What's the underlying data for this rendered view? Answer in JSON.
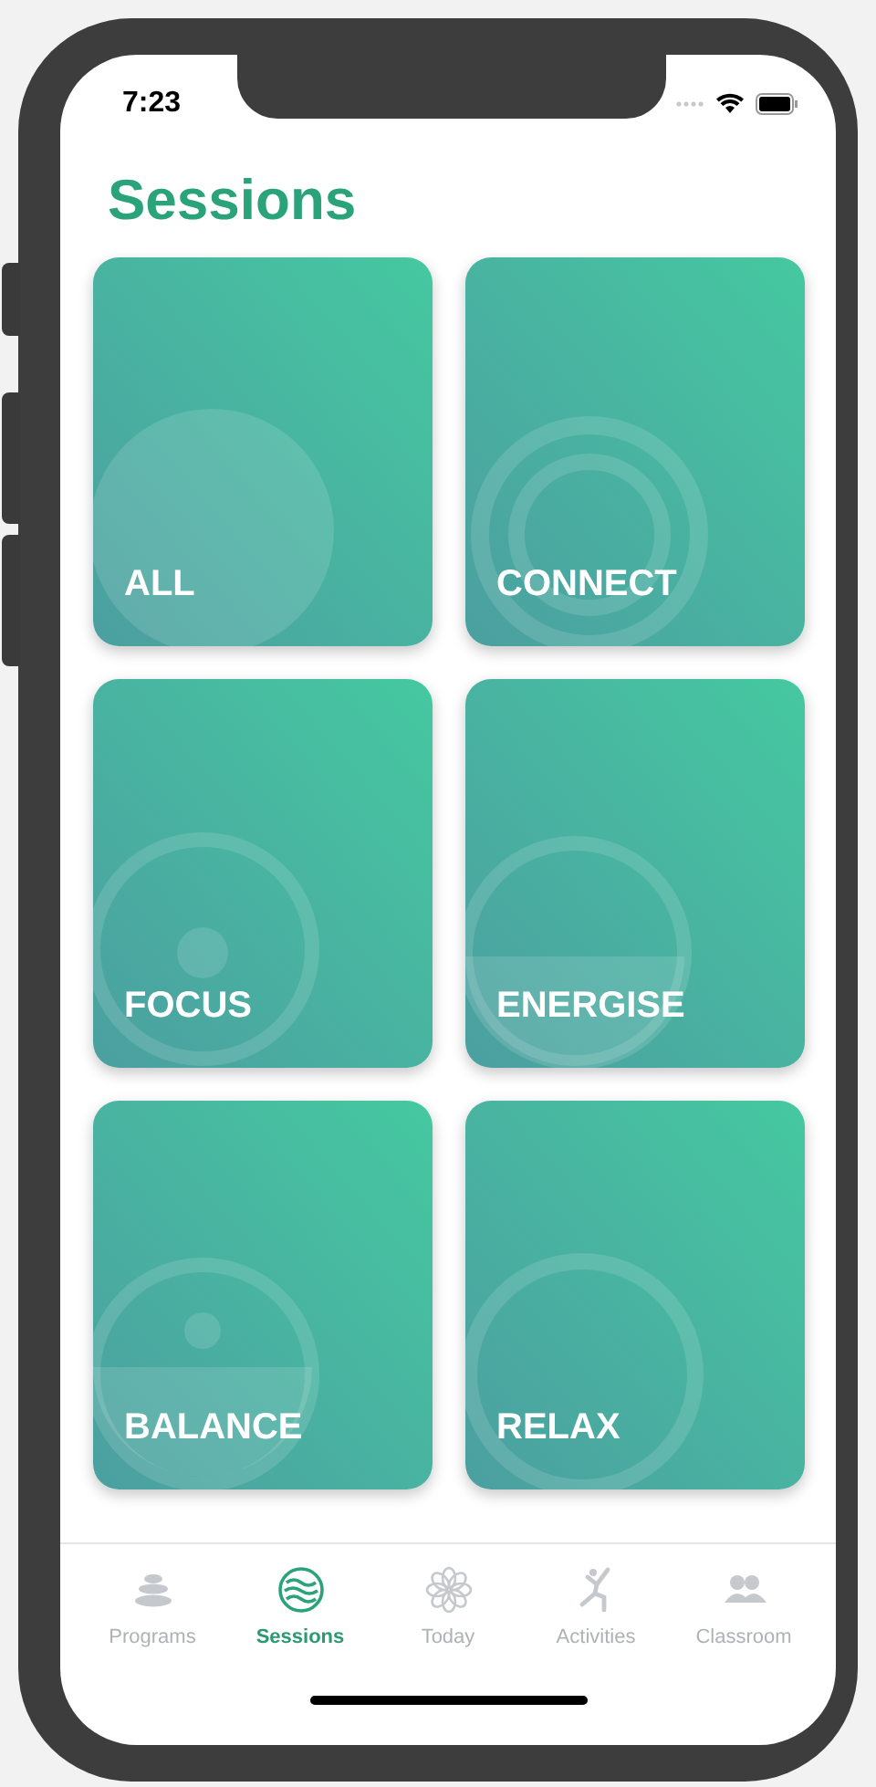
{
  "status_bar": {
    "time": "7:23"
  },
  "title": "Sessions",
  "cards": [
    {
      "label": "ALL",
      "kind": "disc"
    },
    {
      "label": "CONNECT",
      "kind": "rings"
    },
    {
      "label": "FOCUS",
      "kind": "dot"
    },
    {
      "label": "ENERGISE",
      "kind": "half"
    },
    {
      "label": "BALANCE",
      "kind": "balance"
    },
    {
      "label": "RELAX",
      "kind": "ring"
    }
  ],
  "tabs": [
    {
      "label": "Programs",
      "kind": "stones",
      "selected": false
    },
    {
      "label": "Sessions",
      "kind": "waves",
      "selected": true
    },
    {
      "label": "Today",
      "kind": "flower",
      "selected": false
    },
    {
      "label": "Activities",
      "kind": "figure",
      "selected": false
    },
    {
      "label": "Classroom",
      "kind": "people",
      "selected": false
    }
  ]
}
